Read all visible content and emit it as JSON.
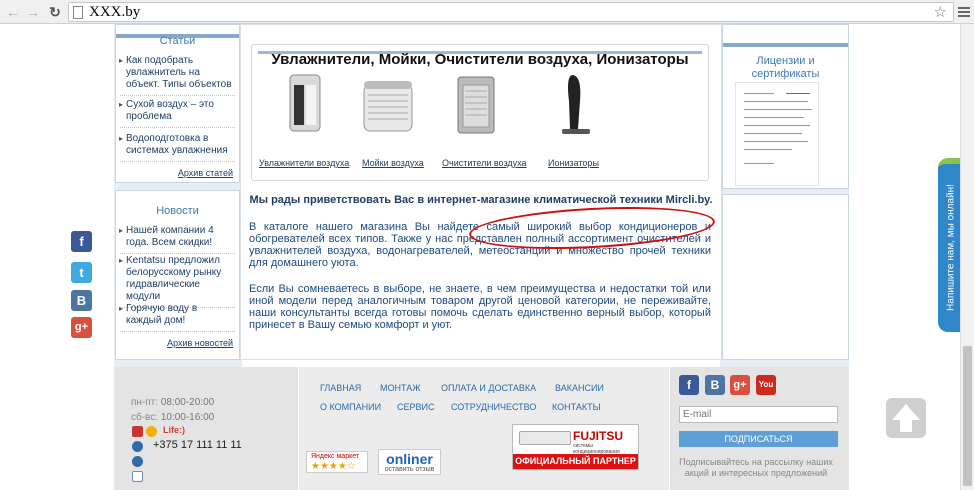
{
  "browser": {
    "url": "XXX.by",
    "back_icon": "arrow-left",
    "forward_icon": "arrow-right",
    "reload_icon": "reload",
    "bookmark_icon": "star",
    "menu_icon": "hamburger"
  },
  "left": {
    "articles": {
      "title": "Статьи",
      "items": [
        "Как подобрать увлажнитель на объект. Типы объектов",
        "Сухой воздух – это проблема",
        "Водоподготовка в системах увлажнения"
      ],
      "archive": "Архив статей"
    },
    "news": {
      "title": "Новости",
      "items": [
        "Нашей компании 4 года. Всем скидки!",
        "Kentatsu предложил белорусскому рынку гидравлические модули",
        "Горячую воду в каждый дом!"
      ],
      "archive": "Архив новостей"
    },
    "social": [
      {
        "icon": "facebook-icon",
        "glyph": "f",
        "color": "#3b5998"
      },
      {
        "icon": "twitter-icon",
        "glyph": "t",
        "color": "#3fa9e0"
      },
      {
        "icon": "vk-icon",
        "glyph": "B",
        "color": "#4c75a3"
      },
      {
        "icon": "google-plus-icon",
        "glyph": "g+",
        "color": "#d9503f"
      }
    ]
  },
  "products": {
    "title": "Увлажнители, Мойки, Очистители воздуха, Ионизаторы",
    "items": [
      {
        "label": "Увлажнители воздуха",
        "icon": "humidifier-image"
      },
      {
        "label": "Мойки воздуха",
        "icon": "air-washer-image"
      },
      {
        "label": "Очистители воздуха",
        "icon": "air-purifier-image"
      },
      {
        "label": "Ионизаторы",
        "icon": "ionizer-image"
      }
    ]
  },
  "main": {
    "welcome": "Мы рады приветствовать Вас в интернет-магазине климатической техники Mircli.by.",
    "para1": "В каталоге нашего магазина Вы найдете самый широкий выбор кондиционеров и обогревателей всех типов. Также у нас представлен полный ассортимент очистителей и увлажнителей воздуха, водонагревателей, метеостанций и множество прочей техники для домашнего уюта.",
    "para2": "Если Вы сомневаетесь в выборе, не знаете, в чем преимущества и недостатки той или иной модели перед аналогичным товаром другой ценовой категории, не переживайте, наши консультанты всегда готовы помочь сделать единственно верный выбор, который принесет в Вашу семью комфорт и уют."
  },
  "right": {
    "title": "Лицензии и сертификаты",
    "side_tab": "Напишите нам, мы онлайн!"
  },
  "footer": {
    "hours": [
      {
        "label": "пн-пт:",
        "value": "08:00-20:00"
      },
      {
        "label": "сб-вс:",
        "value": "10:00-16:00"
      }
    ],
    "life_label": "Life:)",
    "phone": "+375 17 111 11 11",
    "menu_row1": [
      "ГЛАВНАЯ",
      "МОНТАЖ",
      "ОПЛАТА И ДОСТАВКА",
      "ВАКАНСИИ"
    ],
    "menu_row2": [
      "О КОМПАНИИ",
      "СЕРВИС",
      "СОТРУДНИЧЕСТВО",
      "КОНТАКТЫ"
    ],
    "yandex": "Яндекс маркет",
    "yandex_stars": "★★★★☆",
    "onliner": "onliner",
    "onliner_sub": "оставить отзыв",
    "fujitsu_brand": "FUJITSU",
    "fujitsu_sub": "системы кондиционирования",
    "fujitsu_partner": "ОФИЦИАЛЬНЫЙ ПАРТНЕР",
    "email_placeholder": "E-mail",
    "subscribe": "ПОДПИСАТЬСЯ",
    "subscribe_text": "Подписывайтесь на рассылку наших акций и интересных предложений",
    "social": [
      {
        "icon": "facebook-icon",
        "glyph": "f",
        "color": "#3b5998"
      },
      {
        "icon": "vk-icon",
        "glyph": "B",
        "color": "#4c75a3"
      },
      {
        "icon": "google-plus-icon",
        "glyph": "g+",
        "color": "#d9503f"
      },
      {
        "icon": "youtube-icon",
        "glyph": "You",
        "color": "#cc2a1e"
      }
    ]
  },
  "colors": {
    "accent_blue": "#3d78b3",
    "link_dark": "#1f3f66",
    "highlight_oval": "#d01010"
  }
}
